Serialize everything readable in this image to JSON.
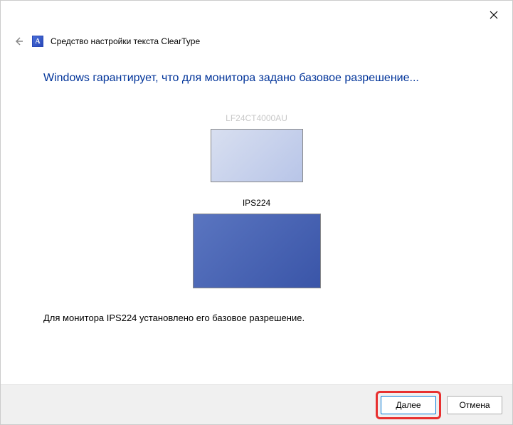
{
  "header": {
    "title": "Средство настройки текста ClearType"
  },
  "main": {
    "heading": "Windows гарантирует, что для монитора задано базовое разрешение...",
    "monitor1": {
      "label": "LF24CT4000AU"
    },
    "monitor2": {
      "label": "IPS224"
    },
    "status": "Для монитора IPS224 установлено его базовое разрешение."
  },
  "footer": {
    "next": "Далее",
    "cancel": "Отмена"
  },
  "icons": {
    "app_glyph": "A"
  }
}
